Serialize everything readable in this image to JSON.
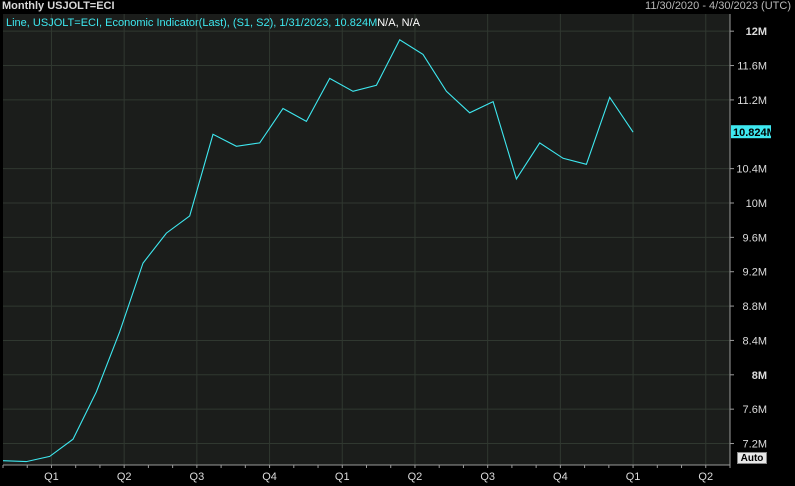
{
  "header": {
    "title": "Monthly USJOLT=ECI",
    "date_range": "11/30/2020 - 4/30/2023 (UTC)"
  },
  "legend": {
    "series_text": "Line, USJOLT=ECI, Economic Indicator(Last), (S1, S2), 1/31/2023, 10.824M",
    "rest_text": "N/A, N/A"
  },
  "controls": {
    "auto_label": "Auto"
  },
  "colors": {
    "line": "#3ee8f0",
    "background": "#000000",
    "plot_bg": "#1b1d1b",
    "grid": "#303830",
    "last_value_bg": "#3ee8f0"
  },
  "chart_data": {
    "type": "line",
    "title": "Monthly USJOLT=ECI",
    "xlabel": "",
    "ylabel": "",
    "y_unit": "M",
    "ylim": [
      6.95,
      12.2
    ],
    "x": [
      "2020-11",
      "2020-12",
      "2021-01",
      "2021-02",
      "2021-03",
      "2021-04",
      "2021-05",
      "2021-06",
      "2021-07",
      "2021-08",
      "2021-09",
      "2021-10",
      "2021-11",
      "2021-12",
      "2022-01",
      "2022-02",
      "2022-03",
      "2022-04",
      "2022-05",
      "2022-06",
      "2022-07",
      "2022-08",
      "2022-09",
      "2022-10",
      "2022-11",
      "2022-12",
      "2023-01"
    ],
    "series": [
      {
        "values": [
          7.0,
          6.99,
          7.05,
          7.25,
          7.8,
          8.5,
          9.3,
          9.65,
          9.85,
          10.8,
          10.66,
          10.7,
          11.1,
          10.95,
          11.45,
          11.3,
          11.37,
          11.9,
          11.73,
          11.3,
          11.05,
          11.18,
          10.28,
          10.7,
          10.52,
          10.45,
          11.23,
          10.824
        ]
      }
    ],
    "y_ticks": [
      {
        "value": 12.0,
        "label": "12M",
        "bold": true
      },
      {
        "value": 11.6,
        "label": "11.6M",
        "bold": false
      },
      {
        "value": 11.2,
        "label": "11.2M",
        "bold": false
      },
      {
        "value": 10.4,
        "label": "10.4M",
        "bold": false
      },
      {
        "value": 10.0,
        "label": "10M",
        "bold": false
      },
      {
        "value": 9.6,
        "label": "9.6M",
        "bold": false
      },
      {
        "value": 9.2,
        "label": "9.2M",
        "bold": false
      },
      {
        "value": 8.8,
        "label": "8.8M",
        "bold": false
      },
      {
        "value": 8.4,
        "label": "8.4M",
        "bold": false
      },
      {
        "value": 8.0,
        "label": "8M",
        "bold": true
      },
      {
        "value": 7.6,
        "label": "7.6M",
        "bold": false
      },
      {
        "value": 7.2,
        "label": "7.2M",
        "bold": false
      }
    ],
    "x_ticks": [
      {
        "at": "2021-01",
        "label": "Q1"
      },
      {
        "at": "2021-04",
        "label": "Q2"
      },
      {
        "at": "2021-07",
        "label": "Q3"
      },
      {
        "at": "2021-10",
        "label": "Q4"
      },
      {
        "at": "2022-01",
        "label": "Q1"
      },
      {
        "at": "2022-04",
        "label": "Q2"
      },
      {
        "at": "2022-07",
        "label": "Q3"
      },
      {
        "at": "2022-10",
        "label": "Q4"
      },
      {
        "at": "2023-01",
        "label": "Q1"
      },
      {
        "at": "2023-04",
        "label": "Q2"
      }
    ],
    "x_range": [
      "2020-11",
      "2023-05"
    ],
    "last_value": {
      "value": 10.824,
      "label": "10.824M"
    },
    "grid": true
  }
}
